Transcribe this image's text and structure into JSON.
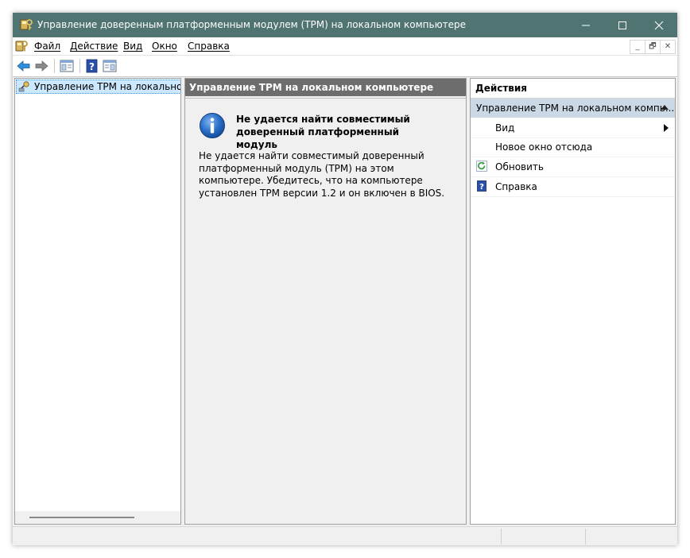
{
  "window": {
    "title": "Управление доверенным платформенным модулем (TPM) на локальном компьютере",
    "titlebar_color": "#4f7472",
    "icons": {
      "app": "tpm-key-icon",
      "minimize": "minimize-icon",
      "maximize": "maximize-icon",
      "close": "close-icon"
    }
  },
  "menubar": {
    "items": [
      {
        "label": "Файл"
      },
      {
        "label": "Действие"
      },
      {
        "label": "Вид"
      },
      {
        "label": "Окно"
      },
      {
        "label": "Справка"
      }
    ],
    "mdi_buttons": {
      "minimize": "_",
      "restore": "🗗",
      "close": "✕"
    }
  },
  "toolbar": {
    "buttons": [
      "back-arrow-icon",
      "forward-arrow-icon",
      "show-hide-tree-icon",
      "help-icon",
      "show-hide-action-pane-icon"
    ]
  },
  "tree": {
    "root_label": "Управление TPM на локальном к"
  },
  "center": {
    "header": "Управление TPM на локальном компьютере",
    "error_title": "Не удается найти совместимый доверенный платформенный модуль",
    "error_body": "Не удается найти совместимый доверенный платформенный модуль (TPM) на этом компьютере. Убедитесь, что на компьютере установлен TPM версии 1.2 и он включен в BIOS."
  },
  "actions": {
    "header": "Действия",
    "group": "Управление TPM на локальном компь...",
    "items": [
      {
        "label": "Вид",
        "submenu": true
      },
      {
        "label": "Новое окно отсюда"
      },
      {
        "label": "Обновить",
        "icon": "refresh-icon"
      },
      {
        "label": "Справка",
        "icon": "help-book-icon"
      }
    ]
  },
  "colors": {
    "header_grey": "#6d6d6d",
    "selection": "#cce8ff",
    "action_group": "#cbd9e6"
  }
}
